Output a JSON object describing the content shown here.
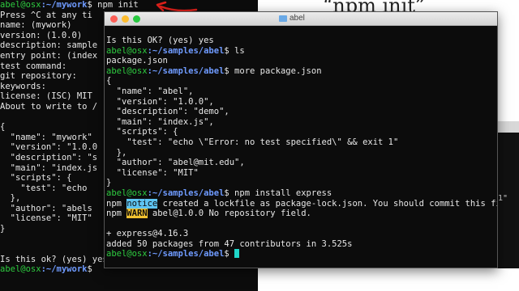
{
  "slide": {
    "title": "“npm init”"
  },
  "back_terminal": {
    "lines": [
      {
        "user": "abel@osx",
        "path": ":~/mywork",
        "prompt": "$",
        "cmd": " npm init"
      },
      {
        "text": "Press ^C at any ti"
      },
      {
        "text": "name: (mywork)"
      },
      {
        "text": "version: (1.0.0)"
      },
      {
        "text": "description: sample"
      },
      {
        "text": "entry point: (index"
      },
      {
        "text": "test command:"
      },
      {
        "text": "git repository:"
      },
      {
        "text": "keywords:"
      },
      {
        "text": "license: (ISC) MIT"
      },
      {
        "text": "About to write to /"
      },
      {
        "text": ""
      },
      {
        "text": "{"
      },
      {
        "text": "  \"name\": \"mywork\""
      },
      {
        "text": "  \"version\": \"1.0.0"
      },
      {
        "text": "  \"description\": \"s"
      },
      {
        "text": "  \"main\": \"index.js"
      },
      {
        "text": "  \"scripts\": {"
      },
      {
        "text": "    \"test\": \"echo"
      },
      {
        "text": "  },"
      },
      {
        "text": "  \"author\": \"abels"
      },
      {
        "text": "  \"license\": \"MIT\""
      },
      {
        "text": "}"
      },
      {
        "text": ""
      },
      {
        "text": ""
      },
      {
        "text": "Is this ok? (yes) yes"
      },
      {
        "user": "abel@osx",
        "path": ":~/mywork",
        "prompt": "$",
        "cmd": " "
      }
    ]
  },
  "right_fragment": {
    "text": "1\""
  },
  "front_terminal": {
    "window_title": "abel",
    "lines": [
      {
        "text": "Is this OK? (yes) yes"
      },
      {
        "user": "abel@osx",
        "path": ":~/samples/abel",
        "prompt": "$",
        "cmd": " ls"
      },
      {
        "text": "package.json"
      },
      {
        "user": "abel@osx",
        "path": ":~/samples/abel",
        "prompt": "$",
        "cmd": " more package.json"
      },
      {
        "text": "{"
      },
      {
        "text": "  \"name\": \"abel\","
      },
      {
        "text": "  \"version\": \"1.0.0\","
      },
      {
        "text": "  \"description\": \"demo\","
      },
      {
        "text": "  \"main\": \"index.js\","
      },
      {
        "text": "  \"scripts\": {"
      },
      {
        "text": "    \"test\": \"echo \\\"Error: no test specified\\\" && exit 1\""
      },
      {
        "text": "  },"
      },
      {
        "text": "  \"author\": \"abel@mit.edu\","
      },
      {
        "text": "  \"license\": \"MIT\""
      },
      {
        "text": "}"
      },
      {
        "user": "abel@osx",
        "path": ":~/samples/abel",
        "prompt": "$",
        "cmd": " npm install express"
      },
      {
        "pre": "npm ",
        "badge": "notice",
        "badge_type": "notice",
        "post": " created a lockfile as package-lock.json. You should commit this file."
      },
      {
        "pre": "npm ",
        "badge": "WARN",
        "badge_type": "warn",
        "post": " abel@1.0.0 No repository field."
      },
      {
        "text": ""
      },
      {
        "text": "+ express@4.16.3"
      },
      {
        "text": "added 50 packages from 47 contributors in 3.525s"
      },
      {
        "user": "abel@osx",
        "path": ":~/samples/abel",
        "prompt": "$",
        "cmd": " ",
        "cursor": true
      }
    ]
  },
  "colors": {
    "terminal_bg": "#0c0c0c",
    "user_color": "#2ecc40",
    "path_color": "#6f9bff",
    "notice_bg": "#5ec4f2",
    "warn_bg": "#f2c230",
    "arrow_color": "#e0201a"
  }
}
